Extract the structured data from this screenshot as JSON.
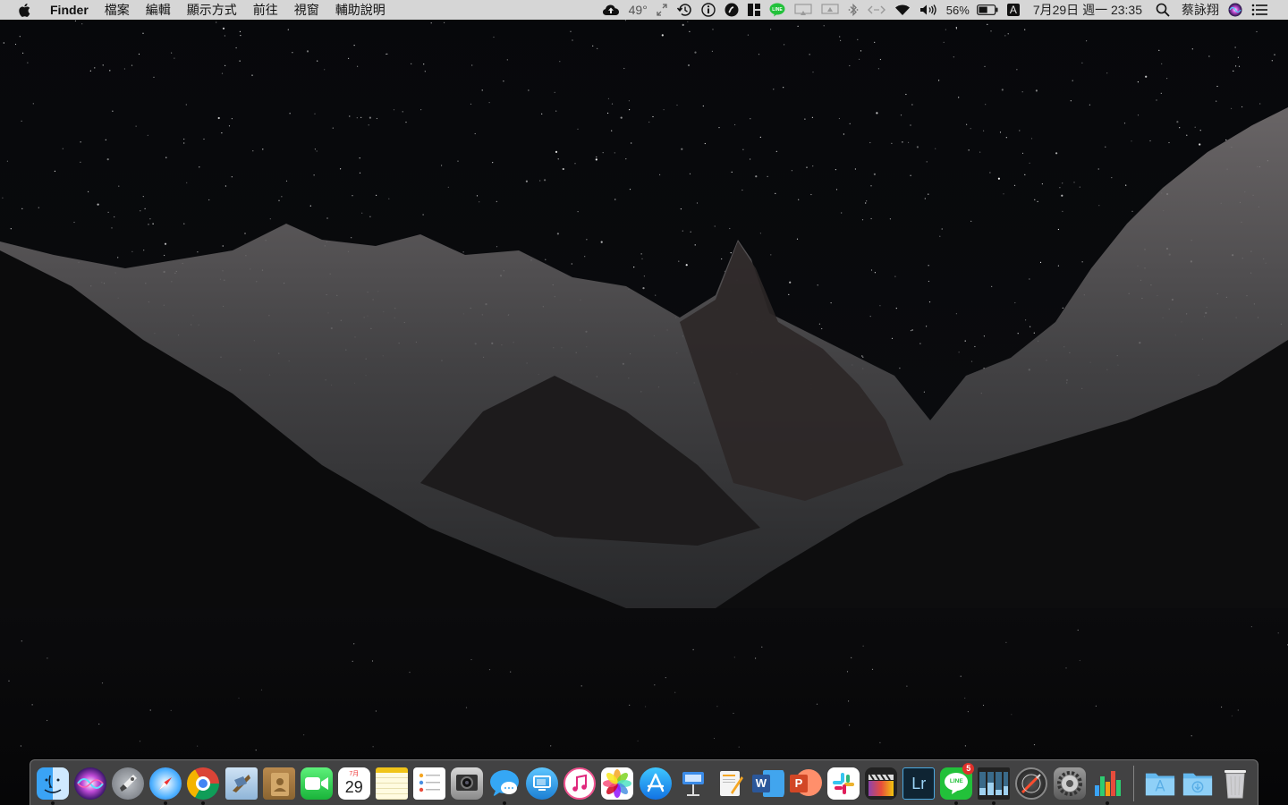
{
  "menubar": {
    "app_name": "Finder",
    "menus": [
      "檔案",
      "編輯",
      "顯示方式",
      "前往",
      "視窗",
      "輔助說明"
    ],
    "status": {
      "weather_temp": "49°",
      "battery_percent": "56%",
      "input_source": "A",
      "datetime": "7月29日 週一  23:35",
      "user_name": "蔡詠翔"
    },
    "status_icons": [
      "cloud-upload-icon",
      "resize-icon",
      "time-machine-icon",
      "info-icon",
      "app-circle-icon",
      "tiles-icon",
      "line-status-icon",
      "airplay-display-icon",
      "airplay-display-2-icon",
      "bluetooth-icon",
      "code-icon",
      "wifi-icon",
      "volume-icon",
      "battery-icon",
      "input-source-icon",
      "spotlight-icon",
      "siri-icon",
      "notification-center-icon"
    ]
  },
  "dock": {
    "apps": [
      {
        "name": "Finder",
        "icon": "finder-icon",
        "running": true
      },
      {
        "name": "Siri",
        "icon": "siri-icon",
        "running": false
      },
      {
        "name": "Launchpad",
        "icon": "launchpad-icon",
        "running": false
      },
      {
        "name": "Safari",
        "icon": "safari-icon",
        "running": true
      },
      {
        "name": "Google Chrome",
        "icon": "chrome-icon",
        "running": true
      },
      {
        "name": "Mail",
        "icon": "mail-icon",
        "running": false
      },
      {
        "name": "Contacts",
        "icon": "contacts-icon",
        "running": false
      },
      {
        "name": "FaceTime",
        "icon": "facetime-icon",
        "running": false
      },
      {
        "name": "Calendar",
        "icon": "calendar-icon",
        "running": false,
        "label_month": "7月",
        "label_day": "29"
      },
      {
        "name": "Notes",
        "icon": "notes-icon",
        "running": false
      },
      {
        "name": "Reminders",
        "icon": "reminders-icon",
        "running": false
      },
      {
        "name": "Photo Booth",
        "icon": "photo-booth-icon",
        "running": false
      },
      {
        "name": "Messages",
        "icon": "messages-icon",
        "running": true
      },
      {
        "name": "Screen Sharing",
        "icon": "screen-sharing-icon",
        "running": false
      },
      {
        "name": "iTunes",
        "icon": "itunes-icon",
        "running": false
      },
      {
        "name": "Photos",
        "icon": "photos-icon",
        "running": false
      },
      {
        "name": "App Store",
        "icon": "app-store-icon",
        "running": false
      },
      {
        "name": "Keynote",
        "icon": "keynote-icon",
        "running": false
      },
      {
        "name": "Pages",
        "icon": "pages-icon",
        "running": false
      },
      {
        "name": "Microsoft Word",
        "icon": "word-icon",
        "running": false,
        "label": "W"
      },
      {
        "name": "Microsoft PowerPoint",
        "icon": "powerpoint-icon",
        "running": false,
        "label": "P"
      },
      {
        "name": "Slack",
        "icon": "slack-icon",
        "running": false
      },
      {
        "name": "Final Cut Pro",
        "icon": "final-cut-icon",
        "running": false
      },
      {
        "name": "Lightroom",
        "icon": "lightroom-icon",
        "running": false,
        "label": "Lr"
      },
      {
        "name": "LINE",
        "icon": "line-icon",
        "running": true,
        "label": "LINE",
        "badge": "5"
      },
      {
        "name": "Hardware Monitor",
        "icon": "monitor-bars-icon",
        "running": true
      },
      {
        "name": "Instruments",
        "icon": "instruments-icon",
        "running": false
      },
      {
        "name": "System Preferences",
        "icon": "system-preferences-icon",
        "running": false
      },
      {
        "name": "Numbers",
        "icon": "numbers-icon",
        "running": true
      }
    ],
    "stacks": [
      {
        "name": "Applications",
        "icon": "applications-folder-icon"
      },
      {
        "name": "Downloads",
        "icon": "downloads-folder-icon"
      },
      {
        "name": "Trash",
        "icon": "trash-icon"
      }
    ]
  },
  "colors": {
    "menubar_bg": "#e8e8e8",
    "dock_bg": "#8c8c8c",
    "sky": "#050608",
    "snow": "#c9cbce",
    "rock": "#2a2626",
    "line_green": "#22c13a",
    "word_blue": "#2b579a",
    "powerpoint_red": "#d24726",
    "lightroom_bg": "#0f2433",
    "badge_red": "#e0302a"
  }
}
